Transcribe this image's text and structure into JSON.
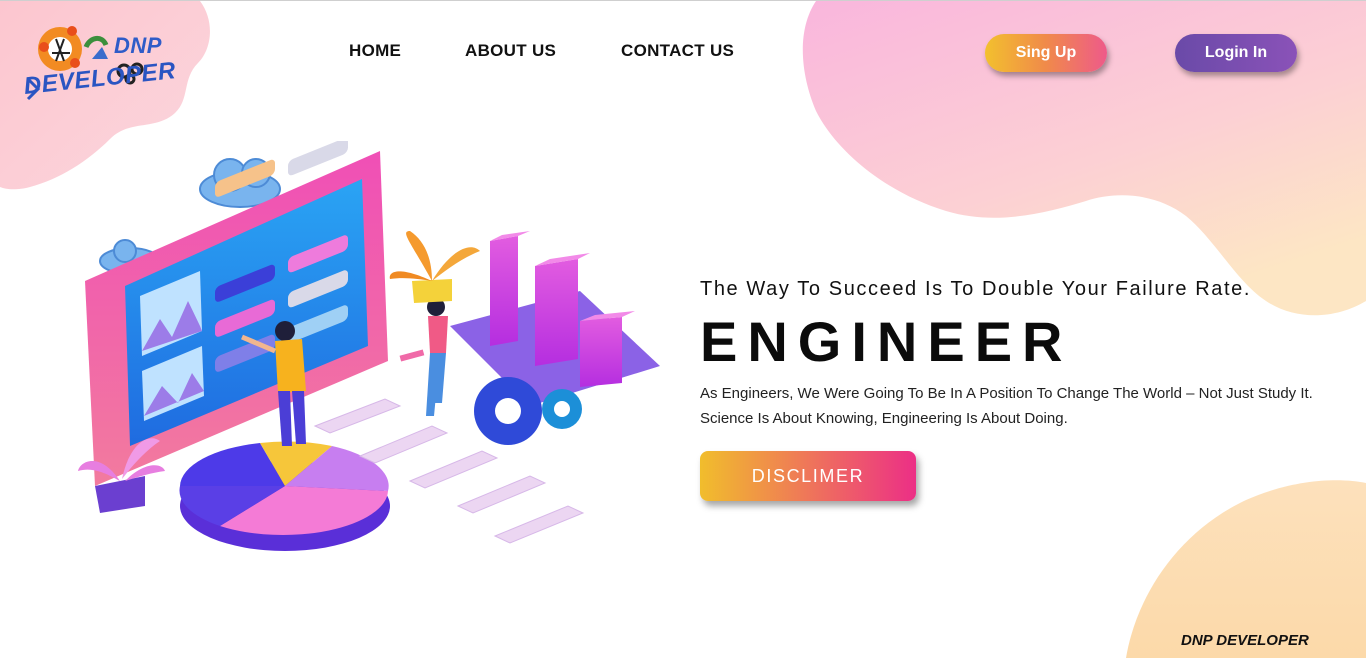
{
  "brand": {
    "logo_line1": "DNP",
    "logo_line2": "DEVELOPER",
    "footer": "DNP DEVELOPER"
  },
  "nav": {
    "items": [
      {
        "label": "HOME"
      },
      {
        "label": "ABOUT US"
      },
      {
        "label": "CONTACT US"
      }
    ]
  },
  "auth": {
    "signup_label": "Sing Up",
    "login_label": "Login In"
  },
  "hero": {
    "tagline": "The Way To Succeed Is To Double Your Failure Rate.",
    "headline": "ENGINEER",
    "description": "As Engineers, We Were Going To Be In A Position To Change The World – Not Just Study It. Science Is About Knowing, Engineering Is About Doing.",
    "cta_label": "DISCLIMER"
  },
  "colors": {
    "blob_pink": "#fbc7d4",
    "blob_peach": "#fde0b8",
    "signup_gradient": [
      "#f3c02e",
      "#ee5a8a"
    ],
    "login_gradient": [
      "#6a4aa8",
      "#8a52b8"
    ],
    "cta_gradient": [
      "#f1bd2c",
      "#ec2f86"
    ]
  }
}
